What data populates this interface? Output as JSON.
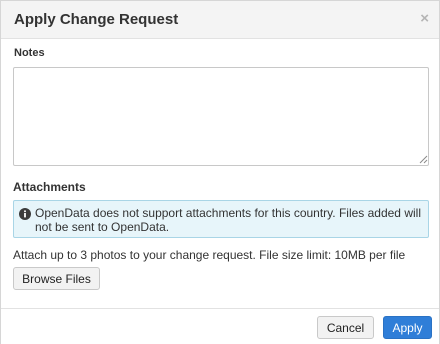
{
  "dialog": {
    "title": "Apply Change Request",
    "close_glyph": "×"
  },
  "notes": {
    "label": "Notes",
    "value": "",
    "placeholder": ""
  },
  "attachments": {
    "label": "Attachments",
    "info_icon": "info-circle-icon",
    "info_message": "OpenData does not support attachments for this country. Files added will not be sent to OpenData.",
    "description": "Attach up to 3 photos to your change request. File size limit: 10MB per file",
    "browse_label": "Browse Files"
  },
  "footer": {
    "cancel_label": "Cancel",
    "apply_label": "Apply"
  },
  "colors": {
    "primary": "#2f7ed8",
    "info_background": "#e7f5fa",
    "info_border": "#a9d5e6",
    "header_background": "#f4f4f4"
  }
}
